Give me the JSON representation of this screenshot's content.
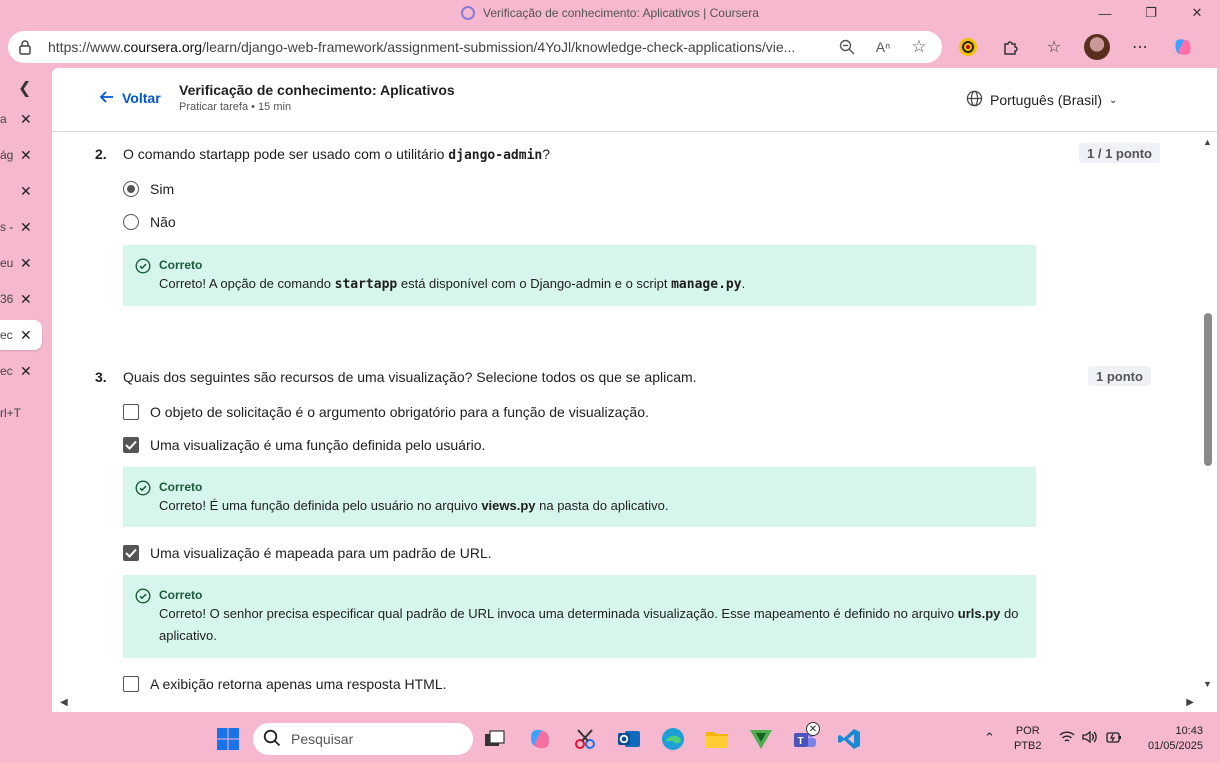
{
  "window": {
    "title": "Verificação de conhecimento: Aplicativos | Coursera"
  },
  "browser": {
    "url_prefix": "https://www.",
    "url_domain": "coursera.org",
    "url_path": "/learn/django-web-framework/assignment-submission/4YoJl/knowledge-check-applications/vie..."
  },
  "sidebar": {
    "tabs": [
      {
        "frag": "a"
      },
      {
        "frag": "ág"
      },
      {
        "frag": ""
      },
      {
        "frag": "s -"
      },
      {
        "frag": "eu"
      },
      {
        "frag": "36"
      },
      {
        "frag": "ec"
      },
      {
        "frag": "ec"
      }
    ],
    "shortcut": "rl+T"
  },
  "header": {
    "back_label": "Voltar",
    "title": "Verificação de conhecimento: Aplicativos",
    "subtitle": "Praticar tarefa • 15 min",
    "language": "Português (Brasil)"
  },
  "questions": {
    "q2": {
      "number": "2.",
      "text_before": "O comando startapp pode ser usado com o utilitário ",
      "text_code": "django-admin",
      "text_after": "?",
      "points": "1 / 1 ponto",
      "options": [
        {
          "label": "Sim",
          "selected": true
        },
        {
          "label": "Não",
          "selected": false
        }
      ],
      "feedback": {
        "head": "Correto",
        "t1": "Correto! A opção de comando ",
        "c1": "startapp",
        "t2": " está disponível com o Django-admin e o script ",
        "c2": "manage.py",
        "t3": "."
      }
    },
    "q3": {
      "number": "3.",
      "text": "Quais dos seguintes são recursos de uma visualização? Selecione todos os que se aplicam.",
      "points": "1 ponto",
      "options": [
        {
          "label": "O objeto de solicitação é o argumento obrigatório para a função de visualização.",
          "checked": false
        },
        {
          "label": "Uma visualização é uma função definida pelo usuário.",
          "checked": true
        },
        {
          "label": "Uma visualização é mapeada para um padrão de URL.",
          "checked": true
        },
        {
          "label": "A exibição retorna apenas uma resposta HTML.",
          "checked": false
        }
      ],
      "feedback1": {
        "head": "Correto",
        "t1": "Correto! É uma função definida pelo usuário no arquivo ",
        "b1": "views.py",
        "t2": " na pasta do aplicativo."
      },
      "feedback2": {
        "head": "Correto",
        "t1": "Correto! O senhor precisa especificar qual padrão de URL invoca uma determinada visualização. Esse mapeamento é definido no arquivo ",
        "b1": "urls.py",
        "t2": " do aplicativo."
      }
    }
  },
  "taskbar": {
    "search_placeholder": "Pesquisar",
    "lang_top": "POR",
    "lang_bottom": "PTB2",
    "time": "10:43",
    "date": "01/05/2025"
  }
}
